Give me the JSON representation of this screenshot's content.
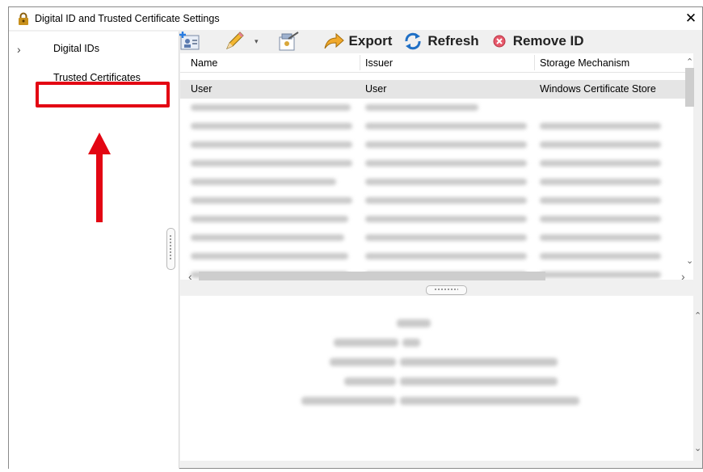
{
  "window": {
    "title": "Digital ID and Trusted Certificate Settings",
    "close_glyph": "✕"
  },
  "tree": {
    "expander_glyph": "›",
    "items": [
      {
        "label": "Digital IDs"
      },
      {
        "label": "Trusted Certificates",
        "highlighted": true
      }
    ]
  },
  "toolbar": {
    "add_icon": "add-id-icon",
    "edit_icon": "pencil-icon",
    "usage_icon": "usage-options-icon",
    "export_label": "Export",
    "refresh_label": "Refresh",
    "remove_label": "Remove ID",
    "caret": "▾"
  },
  "table": {
    "columns": [
      "Name",
      "Issuer",
      "Storage Mechanism"
    ],
    "rows": [
      {
        "name": "User",
        "issuer": "User",
        "storage": "Windows Certificate Store"
      }
    ],
    "blurred_rows_count_hint": "redacted"
  },
  "scroll": {
    "up": "⌃",
    "down": "⌄",
    "left": "‹",
    "right": "›"
  },
  "colors": {
    "callout": "#e30613",
    "selected_row": "#e5e5e5",
    "panel_bg": "#f0f0f0"
  }
}
